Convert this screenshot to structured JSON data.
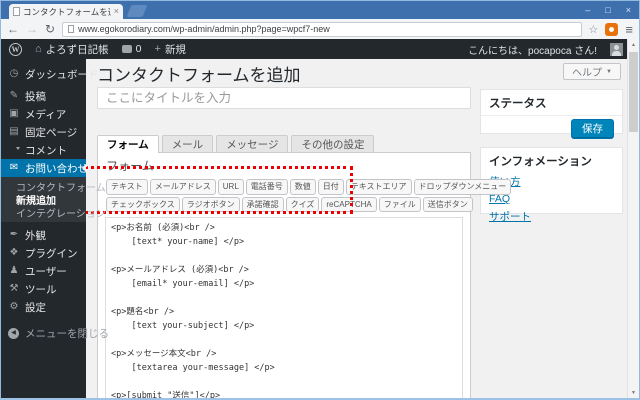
{
  "browser": {
    "tab_title": "コンタクトフォームを追加 ‹ よろ",
    "close_tab_glyph": "×",
    "url": "www.egokorodiary.com/wp-admin/admin.php?page=wpcf7-new",
    "controls": {
      "minimize": "–",
      "maximize": "□",
      "close": "×"
    },
    "nav": {
      "back": "←",
      "forward": "→",
      "reload": "↻",
      "bookmark": "☆",
      "menu": "≡"
    }
  },
  "admin_bar": {
    "wp_logo": "W",
    "home_glyph": "⌂",
    "site_name": "よろず日記帳",
    "comment_count": "0",
    "plus_glyph": "+",
    "new_label": "新規",
    "greeting": "こんにちは、pocapoca さん!"
  },
  "sidebar": {
    "items": [
      {
        "label": "ダッシュボード",
        "glyph": "◷"
      },
      {
        "label": "投稿",
        "glyph": "✎"
      },
      {
        "label": "メディア",
        "glyph": "▣"
      },
      {
        "label": "固定ページ",
        "glyph": "▤"
      },
      {
        "label": "コメント",
        "glyph": ""
      },
      {
        "label": "お問い合わせ",
        "glyph": "✉"
      },
      {
        "label": "外観",
        "glyph": "✒"
      },
      {
        "label": "プラグイン",
        "glyph": "❖"
      },
      {
        "label": "ユーザー",
        "glyph": "♟"
      },
      {
        "label": "ツール",
        "glyph": "⚒"
      },
      {
        "label": "設定",
        "glyph": "⚙"
      }
    ],
    "submenu": [
      {
        "label": "コンタクトフォーム"
      },
      {
        "label": "新規追加",
        "current": true
      },
      {
        "label": "インテグレーション"
      }
    ],
    "collapse_label": "メニューを閉じる",
    "collapse_glyph": "◀"
  },
  "main": {
    "heading": "コンタクトフォームを追加",
    "title_placeholder": "ここにタイトルを入力",
    "help_label": "ヘルプ",
    "help_caret": "▼",
    "tabs": [
      {
        "label": "フォーム"
      },
      {
        "label": "メール"
      },
      {
        "label": "メッセージ"
      },
      {
        "label": "その他の設定"
      }
    ],
    "form": {
      "section_heading": "フォーム",
      "tag_buttons_row1": [
        "テキスト",
        "メールアドレス",
        "URL",
        "電話番号",
        "数値",
        "日付",
        "テキストエリア",
        "ドロップダウンメニュー"
      ],
      "tag_buttons_row2": [
        "チェックボックス",
        "ラジオボタン",
        "承諾確認",
        "クイズ",
        "reCAPTCHA",
        "ファイル",
        "送信ボタン"
      ],
      "template": "<p>お名前 (必須)<br />\n    [text* your-name] </p>\n\n<p>メールアドレス (必須)<br />\n    [email* your-email] </p>\n\n<p>題名<br />\n    [text your-subject] </p>\n\n<p>メッセージ本文<br />\n    [textarea your-message] </p>\n\n<p>[submit \"送信\"]</p>"
    }
  },
  "side_panel": {
    "status": {
      "title": "ステータス",
      "save_label": "保存"
    },
    "information": {
      "title": "インフォメーション",
      "links": [
        "使い方",
        "FAQ",
        "サポート"
      ]
    }
  },
  "colors": {
    "titlebar_blue": "#3e70ae",
    "admin_dark": "#23282d",
    "accent_blue": "#0073aa",
    "primary_button": "#0085ba",
    "annotation_red": "#ee0000",
    "page_bg": "#f1f1f1"
  }
}
